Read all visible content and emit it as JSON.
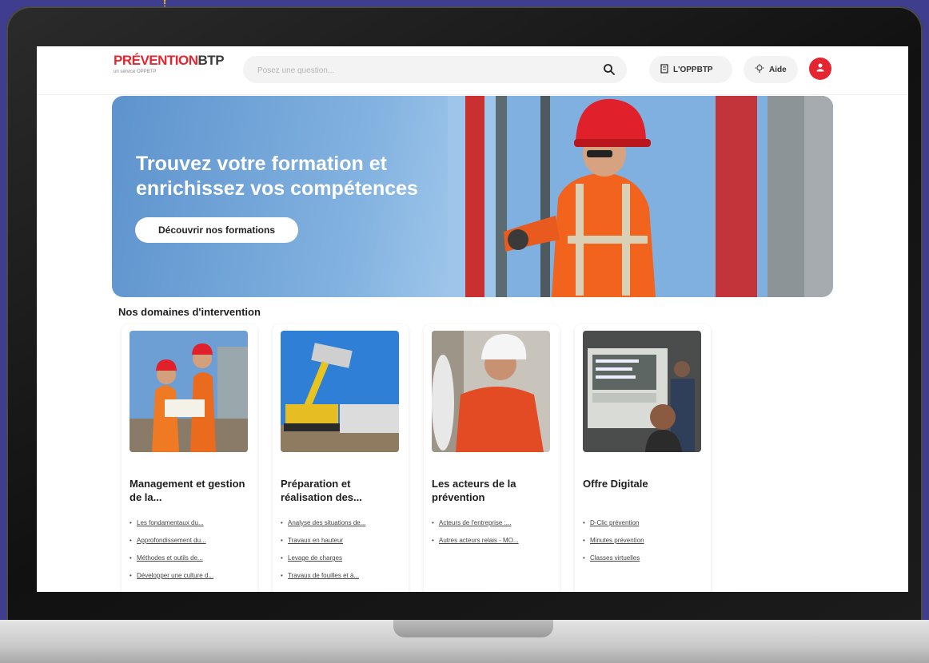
{
  "header": {
    "logo_red": "PRÉVENTION",
    "logo_dark": "BTP",
    "logo_sub": "un service OPPBTP",
    "search_placeholder": "Posez une question...",
    "oppbtp_label": "L'OPPBTP",
    "help_label": "Aide"
  },
  "hero": {
    "title": "Trouvez votre formation et enrichissez vos compétences",
    "cta_label": "Découvrir nos formations"
  },
  "domains": {
    "section_title": "Nos domaines d'intervention",
    "cards": [
      {
        "title": "Management et gestion de la...",
        "links": [
          "Les fondamentaux du...",
          "Approfondissement du...",
          "Méthodes et outils de...",
          "Développer une culture d..."
        ]
      },
      {
        "title": "Préparation et réalisation des...",
        "links": [
          "Analyse des situations de...",
          "Travaux en hauteur",
          "Levage de charges",
          "Travaux de fouilles et à..."
        ]
      },
      {
        "title": "Les acteurs de la prévention",
        "links": [
          "Acteurs de l'entreprise :...",
          "Autres acteurs relais - MO..."
        ]
      },
      {
        "title": "Offre Digitale",
        "links": [
          "D-Clic prévention",
          "Minutes prévention",
          "Classes virtuelles"
        ]
      }
    ]
  },
  "colors": {
    "brand_red": "#e3262f",
    "background": "#3f3d8e",
    "accent_yellow": "#f6c21a"
  }
}
